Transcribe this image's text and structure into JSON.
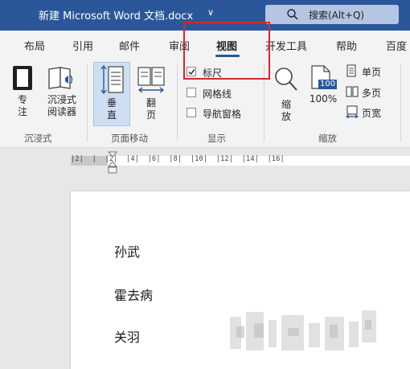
{
  "titlebar": {
    "doc_title": "新建 Microsoft Word 文档.docx",
    "title_chevron": "∨",
    "search": {
      "icon": "search-icon",
      "label": "搜索(Alt+Q)"
    }
  },
  "tabs": [
    {
      "label": "布局"
    },
    {
      "label": "引用"
    },
    {
      "label": "邮件"
    },
    {
      "label": "审阅"
    },
    {
      "label": "视图",
      "active": true
    },
    {
      "label": "开发工具"
    },
    {
      "label": "帮助"
    },
    {
      "label": "百度"
    }
  ],
  "ribbon": {
    "immersive": {
      "focus_label_1": "专",
      "focus_label_2": "注",
      "reader_label_1": "沉浸式",
      "reader_label_2": "阅读器",
      "group_label": "沉浸式"
    },
    "page_move": {
      "vertical_1": "垂",
      "vertical_2": "直",
      "flip_1": "翻",
      "flip_2": "页",
      "group_label": "页面移动"
    },
    "show": {
      "ruler": {
        "label": "标尺",
        "checked": true
      },
      "gridlines": {
        "label": "网格线",
        "checked": false
      },
      "navpane": {
        "label": "导航窗格",
        "checked": false
      },
      "group_label": "显示"
    },
    "zoom": {
      "zoom_1": "缩",
      "zoom_2": "放",
      "hundred_badge": "100",
      "hundred_label": "100%",
      "one_page": "单页",
      "multi_page": "多页",
      "page_width": "页宽",
      "group_label": "缩放"
    }
  },
  "ruler": {
    "ticks": "|2|  |  |2|  |4|  |6|  |8|  |10|  |12|  |14|  |16|"
  },
  "document": {
    "lines": [
      "孙武",
      "霍去病",
      "关羽"
    ]
  },
  "colors": {
    "titlebar_bg": "#2b579a",
    "ribbon_bg": "#f3f3f3",
    "highlight_red": "#d9262c",
    "selected_bg": "#cfdff3"
  }
}
